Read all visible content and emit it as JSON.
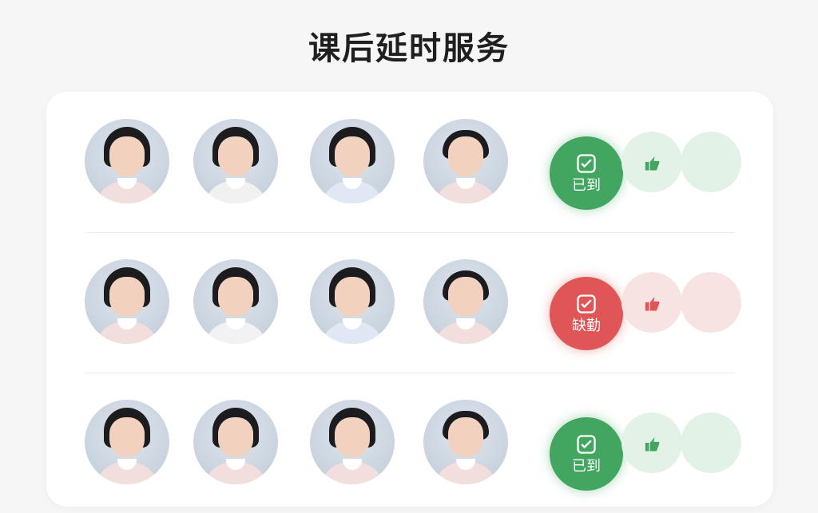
{
  "page": {
    "title": "课后延时服务"
  },
  "rows": [
    {
      "status": {
        "label": "已到",
        "type": "present"
      }
    },
    {
      "status": {
        "label": "缺勤",
        "type": "absent"
      }
    },
    {
      "status": {
        "label": "已到",
        "type": "present"
      }
    }
  ],
  "colors": {
    "present": "#42a660",
    "absent": "#e05656"
  },
  "icons": {
    "status": "check-square-icon",
    "secondary": "thumb-icon"
  }
}
